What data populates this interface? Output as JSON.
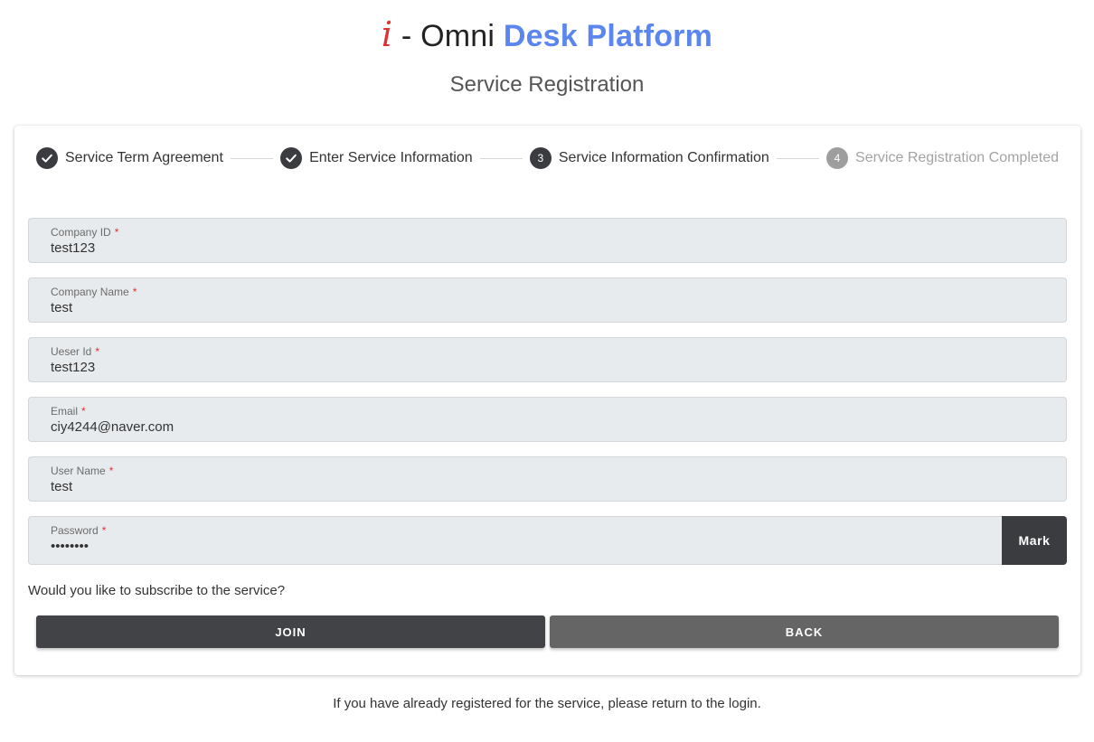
{
  "brand": {
    "logo_letter": "i",
    "separator": " - ",
    "name_part1": "Omni",
    "name_part2": "Desk Platform"
  },
  "page": {
    "subtitle": "Service Registration"
  },
  "stepper": {
    "steps": [
      {
        "label": "Service Term Agreement",
        "state": "completed",
        "icon": "check-icon"
      },
      {
        "label": "Enter Service Information",
        "state": "completed",
        "icon": "check-icon"
      },
      {
        "number": "3",
        "label": "Service Information Confirmation",
        "state": "active"
      },
      {
        "number": "4",
        "label": "Service Registration Completed",
        "state": "disabled"
      }
    ]
  },
  "form": {
    "required_marker": "*",
    "fields": [
      {
        "label": "Company ID",
        "value": "test123"
      },
      {
        "label": "Company Name",
        "value": "test"
      },
      {
        "label": "Ueser Id",
        "value": "test123"
      },
      {
        "label": "Email",
        "value": "ciy4244@naver.com"
      },
      {
        "label": "User Name",
        "value": "test"
      },
      {
        "label": "Password",
        "value": "••••••••"
      }
    ],
    "mark_label": "Mark"
  },
  "confirm": {
    "question": "Would you like to subscribe to the service?",
    "join_label": "JOIN",
    "back_label": "BACK"
  },
  "footer": {
    "text": "If you have already registered for the service, please return to the login."
  },
  "colors": {
    "accent_blue": "#5b86f0",
    "logo_red": "#e03131",
    "dark_button": "#424347",
    "gray_button": "#656565"
  }
}
